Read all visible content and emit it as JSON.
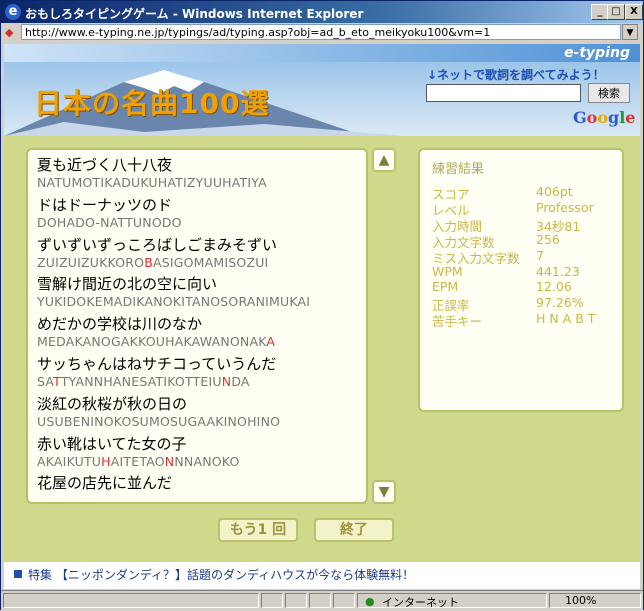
{
  "window": {
    "title": "おもしろタイピングゲーム - Windows Internet Explorer",
    "minimize": "_",
    "maximize": "□",
    "close": "X"
  },
  "address": {
    "url": "http://www.e-typing.ne.jp/typings/ad/typing.asp?obj=ad_b_eto_meikyoku100&vm=1",
    "dropdown": "▼"
  },
  "header": {
    "logo": "e-typing",
    "banner_title": "日本の名曲100選",
    "search_link": "↓ネットで歌詞を調べてみよう！",
    "search_placeholder": "",
    "search_button": "検索",
    "google": [
      "G",
      "o",
      "o",
      "g",
      "l",
      "e"
    ]
  },
  "lyrics": [
    {
      "jp": "夏も近づく八十八夜",
      "romaji": [
        {
          "t": "NATUMOTIKADUKUHATIZYUUHATIYA",
          "e": false
        }
      ]
    },
    {
      "jp": "ドはドーナッツのド",
      "romaji": [
        {
          "t": "DOHADO-NATTUNODO",
          "e": false
        }
      ]
    },
    {
      "jp": "ずいずいずっころばしごまみそずい",
      "romaji": [
        {
          "t": "ZUIZUIZUKKORO",
          "e": false
        },
        {
          "t": "B",
          "e": true
        },
        {
          "t": "ASIGOMAMISOZUI",
          "e": false
        }
      ]
    },
    {
      "jp": "雪解け間近の北の空に向い",
      "romaji": [
        {
          "t": "YUKIDOKEMADIKANOKITANOSORANIMUKAI",
          "e": false
        }
      ]
    },
    {
      "jp": "めだかの学校は川のなか",
      "romaji": [
        {
          "t": "MEDAKANOGAKKOUHAKAWANONAK",
          "e": false
        },
        {
          "t": "A",
          "e": true
        }
      ]
    },
    {
      "jp": "サッちゃんはねサチコっていうんだ",
      "romaji": [
        {
          "t": "SA",
          "e": false
        },
        {
          "t": "T",
          "e": true
        },
        {
          "t": "TYANNHANESATIKOTTEIU",
          "e": false
        },
        {
          "t": "N",
          "e": true
        },
        {
          "t": "DA",
          "e": false
        }
      ]
    },
    {
      "jp": "淡紅の秋桜が秋の日の",
      "romaji": [
        {
          "t": "USUBENINOKOSUMOSUGAAKINOHINO",
          "e": false
        }
      ]
    },
    {
      "jp": "赤い靴はいてた女の子",
      "romaji": [
        {
          "t": "AKAIKUTU",
          "e": false
        },
        {
          "t": "H",
          "e": true
        },
        {
          "t": "AITETAO",
          "e": false
        },
        {
          "t": "N",
          "e": true
        },
        {
          "t": "NNANOKO",
          "e": false
        }
      ]
    },
    {
      "jp": "花屋の店先に並んだ",
      "romaji": []
    }
  ],
  "scroll": {
    "up": "▲",
    "down": "▼"
  },
  "result": {
    "title": "練習結果",
    "rows": [
      {
        "label": "スコア",
        "value": "406pt"
      },
      {
        "label": "レベル",
        "value": "Professor"
      },
      {
        "label": "入力時間",
        "value": "34秒81"
      },
      {
        "label": "入力文字数",
        "value": "256"
      },
      {
        "label": "ミス入力文字数",
        "value": "7"
      },
      {
        "label": "WPM",
        "value": "441.23"
      },
      {
        "label": "EPM",
        "value": "12.06"
      },
      {
        "label": "正誤率",
        "value": "97.26%"
      },
      {
        "label": "苦手キー",
        "value": "H N A B T"
      }
    ]
  },
  "buttons": {
    "retry": "もう1 回",
    "finish": "終了"
  },
  "news": {
    "text": "特集 【ニッポンダンディ？】話題のダンディハウスが今なら体験無料！"
  },
  "status": {
    "zone": "インターネット",
    "zoom": "100%"
  }
}
